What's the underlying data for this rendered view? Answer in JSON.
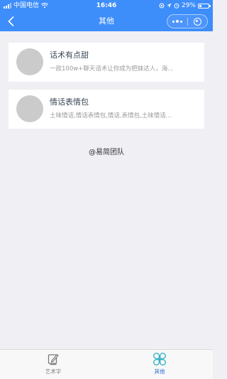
{
  "status_bar": {
    "carrier": "中国电信",
    "time": "16:46",
    "battery_percent": "29%",
    "battery_level": 0.29
  },
  "nav": {
    "title": "其他"
  },
  "cards": [
    {
      "title": "话术有点甜",
      "description": "一款100w+聊天话术让你成为把妹达人，海..."
    },
    {
      "title": "情话表情包",
      "description": "土味情话,情话表情包,情话,表情包,土味情话..."
    }
  ],
  "credit": "@易简团队",
  "tabs": [
    {
      "label": "艺术字",
      "icon": "pen-square-icon",
      "active": false
    },
    {
      "label": "其他",
      "icon": "four-petal-icon",
      "active": true
    }
  ],
  "colors": {
    "header": "#3d8dfa",
    "active_tab": "#2f6fd6",
    "active_icon": "#37b3c6",
    "background": "#efeff4"
  }
}
